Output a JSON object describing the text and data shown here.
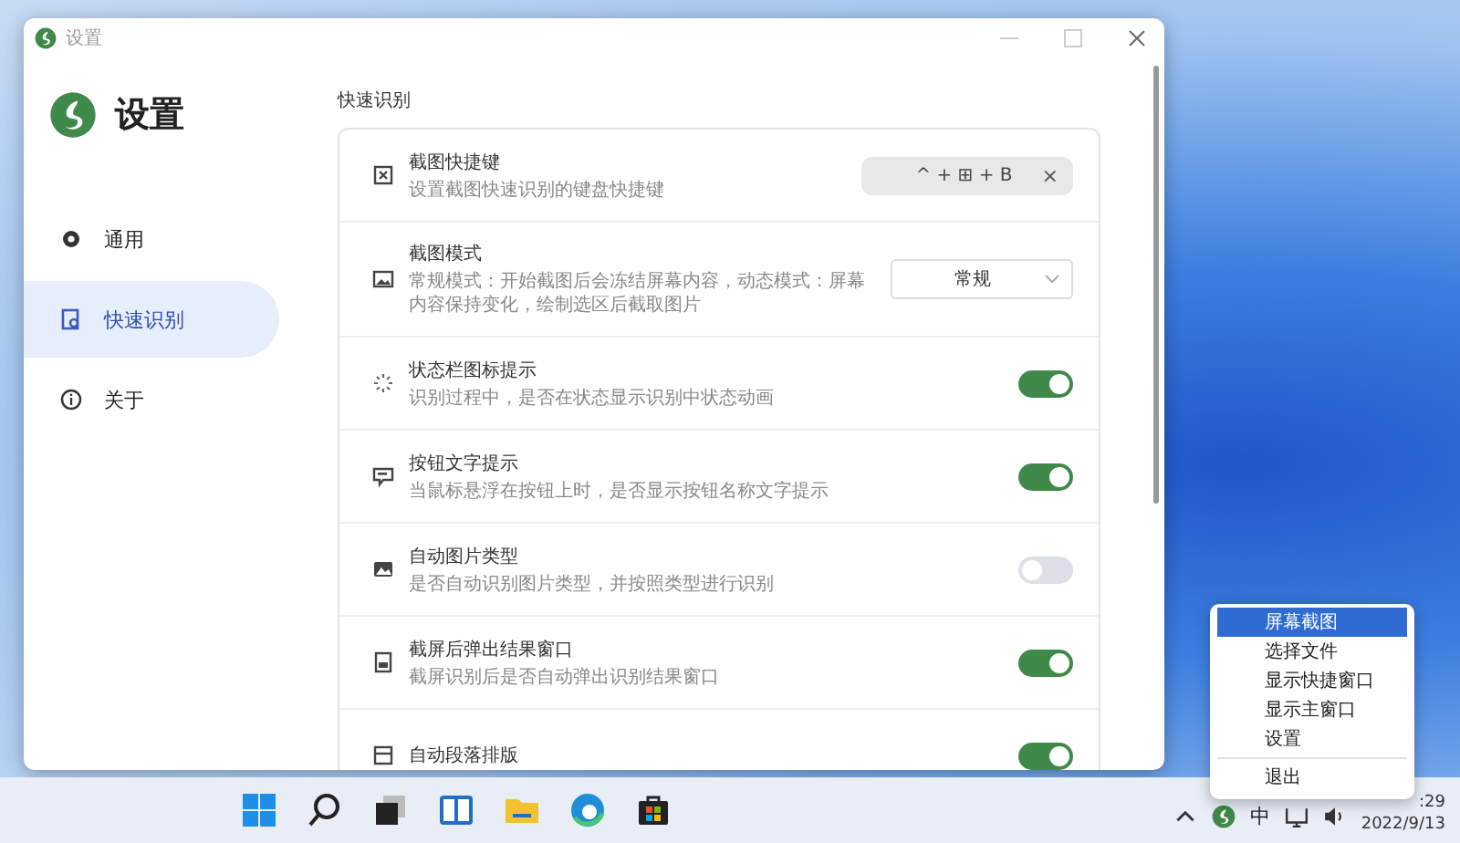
{
  "window": {
    "title": "设置"
  },
  "sidebar": {
    "heading": "设置",
    "items": [
      {
        "label": "通用",
        "selected": false
      },
      {
        "label": "快速识别",
        "selected": true
      },
      {
        "label": "关于",
        "selected": false
      }
    ]
  },
  "section_title": "快速识别",
  "settings": [
    {
      "kind": "shortcut",
      "title": "截图快捷键",
      "description": "设置截图快速识别的键盘快捷键",
      "value": "^ + ⊞ + B",
      "clear": "×"
    },
    {
      "kind": "select",
      "title": "截图模式",
      "description": "常规模式：开始截图后会冻结屏幕内容，动态模式：屏幕内容保持变化，绘制选区后截取图片",
      "value": "常规"
    },
    {
      "kind": "toggle",
      "title": "状态栏图标提示",
      "description": "识别过程中，是否在状态显示识别中状态动画",
      "on": true
    },
    {
      "kind": "toggle",
      "title": "按钮文字提示",
      "description": "当鼠标悬浮在按钮上时，是否显示按钮名称文字提示",
      "on": true
    },
    {
      "kind": "toggle",
      "title": "自动图片类型",
      "description": "是否自动识别图片类型，并按照类型进行识别",
      "on": false
    },
    {
      "kind": "toggle",
      "title": "截屏后弹出结果窗口",
      "description": "截屏识别后是否自动弹出识别结果窗口",
      "on": true
    },
    {
      "kind": "toggle",
      "title": "自动段落排版",
      "on": true
    }
  ],
  "context_menu": [
    {
      "label": "屏幕截图",
      "selected": true
    },
    {
      "label": "选择文件",
      "selected": false
    },
    {
      "label": "显示快捷窗口",
      "selected": false
    },
    {
      "label": "显示主窗口",
      "selected": false
    },
    {
      "label": "设置",
      "selected": false
    },
    {
      "label": "退出",
      "selected": false
    }
  ],
  "taskbar": {
    "input_method": "中",
    "time": ":29",
    "date": "2022/9/13"
  }
}
